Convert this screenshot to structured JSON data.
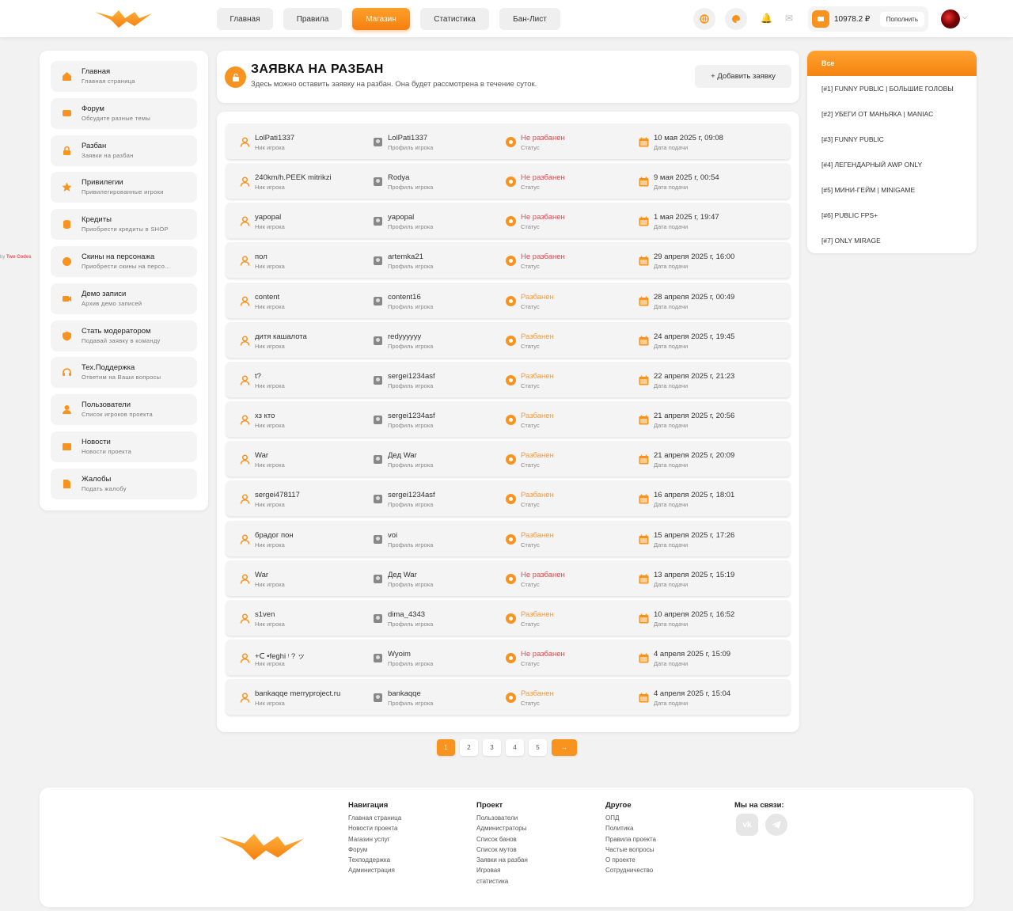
{
  "colors": {
    "accent": "#f7931e",
    "status_not_banned": "#e5484d",
    "status_banned": "#f89a3e"
  },
  "topnav": {
    "items": [
      "Главная",
      "Правила",
      "Магазин",
      "Статистика",
      "Бан-Лист"
    ],
    "active_index": 2
  },
  "balance": {
    "amount": "10978.2 ₽",
    "topup_label": "Пополнить"
  },
  "credit": {
    "prefix": "by",
    "name": "Two Codes"
  },
  "sidebar": {
    "items": [
      {
        "title": "Главная",
        "subtitle": "Главная страница",
        "icon": "home-icon"
      },
      {
        "title": "Форум",
        "subtitle": "Обсудите разные темы",
        "icon": "chat-icon"
      },
      {
        "title": "Разбан",
        "subtitle": "Заявки на разбан",
        "icon": "lock-icon"
      },
      {
        "title": "Привилегии",
        "subtitle": "Привилегированные игроки",
        "icon": "star-icon"
      },
      {
        "title": "Кредиты",
        "subtitle": "Приобрести кредиты в SHOP",
        "icon": "coins-icon"
      },
      {
        "title": "Скины на персонажа",
        "subtitle": "Приобрести скины на персо...",
        "icon": "skin-icon"
      },
      {
        "title": "Демо записи",
        "subtitle": "Архив демо записей",
        "icon": "video-icon"
      },
      {
        "title": "Стать модератором",
        "subtitle": "Подавай заявку в команду",
        "icon": "shield-icon"
      },
      {
        "title": "Тех.Поддержка",
        "subtitle": "Ответим на Ваши вопросы",
        "icon": "headset-icon"
      },
      {
        "title": "Пользователи",
        "subtitle": "Список игроков проекта",
        "icon": "user-icon"
      },
      {
        "title": "Новости",
        "subtitle": "Новости проекта",
        "icon": "news-icon"
      },
      {
        "title": "Жалобы",
        "subtitle": "Подать жалобу",
        "icon": "report-icon"
      }
    ]
  },
  "page": {
    "title": "ЗАЯВКА НА РАЗБАН",
    "subtitle": "Здесь можно оставить заявку на разбан. Она будет рассмотрена в течение суток.",
    "add_button": "+ Добавить заявку"
  },
  "labels": {
    "nick": "Ник игрока",
    "profile": "Профиль игрока",
    "status": "Статус",
    "date": "Дата подачи"
  },
  "appeals": [
    {
      "nick": "LolPati1337",
      "profile": "LolPati1337",
      "status": "Не разбанен",
      "date": "10 мая 2025 г, 09:08"
    },
    {
      "nick": "240km/h.PEEK mitrikzi",
      "profile": "Rodya",
      "status": "Не разбанен",
      "date": "9 мая 2025 г, 00:54"
    },
    {
      "nick": "yapopal",
      "profile": "yapopal",
      "status": "Не разбанен",
      "date": "1 мая 2025 г, 19:47"
    },
    {
      "nick": "пол",
      "profile": "artemka21",
      "status": "Не разбанен",
      "date": "29 апреля 2025 г, 16:00"
    },
    {
      "nick": "content",
      "profile": "content16",
      "status": "Разбанен",
      "date": "28 апреля 2025 г, 00:49"
    },
    {
      "nick": "дитя кашалота",
      "profile": "redyyyyyy",
      "status": "Разбанен",
      "date": "24 апреля 2025 г, 19:45"
    },
    {
      "nick": "t?",
      "profile": "sergei1234asf",
      "status": "Разбанен",
      "date": "22 апреля 2025 г, 21:23"
    },
    {
      "nick": "хз кто",
      "profile": "sergei1234asf",
      "status": "Разбанен",
      "date": "21 апреля 2025 г, 20:56"
    },
    {
      "nick": "War",
      "profile": "Дед War",
      "status": "Разбанен",
      "date": "21 апреля 2025 г, 20:09"
    },
    {
      "nick": "sergei478117",
      "profile": "sergei1234asf",
      "status": "Разбанен",
      "date": "16 апреля 2025 г, 18:01"
    },
    {
      "nick": "брадог пон",
      "profile": "voi",
      "status": "Разбанен",
      "date": "15 апреля 2025 г, 17:26"
    },
    {
      "nick": "War",
      "profile": "Дед War",
      "status": "Не разбанен",
      "date": "13 апреля 2025 г, 15:19"
    },
    {
      "nick": "s1ven",
      "profile": "dima_4343",
      "status": "Разбанен",
      "date": "10 апреля 2025 г, 16:52"
    },
    {
      "nick": "+ᑕ •feghi ᵎ ? ッ",
      "profile": "Wyoim",
      "status": "Не разбанен",
      "date": "4 апреля 2025 г, 15:09"
    },
    {
      "nick": "bankaqqe merryproject.ru",
      "profile": "bankaqqe",
      "status": "Разбанен",
      "date": "4 апреля 2025 г, 15:04"
    }
  ],
  "pagination": {
    "pages": [
      "1",
      "2",
      "3",
      "4",
      "5"
    ],
    "current": "1",
    "next": "→"
  },
  "servers": {
    "all_label": "Все",
    "items": [
      "[#1] FUNNY PUBLIC | БОЛЬШИЕ ГОЛОВЫ",
      "[#2] УБЕГИ ОТ МАНЬЯКА | MANIAC",
      "[#3] FUNNY PUBLIC",
      "[#4] ЛЕГЕНДАРНЫЙ AWP ONLY",
      "[#5] МИНИ-ГЕЙМ | MINIGAME",
      "[#6] PUBLIC FPS+",
      "[#7] ONLY MIRAGE"
    ]
  },
  "footer": {
    "nav": {
      "title": "Навигация",
      "links": [
        "Главная страница",
        "Новости проекта",
        "Магазин услуг",
        "Форум",
        "Техподдержка",
        "Администрация"
      ]
    },
    "project": {
      "title": "Проект",
      "links": [
        "Пользователи",
        "Администраторы",
        "Список банов",
        "Список мутов",
        "Заявки на разбан",
        "Игровая",
        "статистика"
      ]
    },
    "other": {
      "title": "Другое",
      "links": [
        "ОПД",
        "Политика",
        "Правила проекта",
        "Частые вопросы",
        "О проекте",
        "Сотрудничество"
      ]
    },
    "social": {
      "title": "Мы на связи:",
      "vk_icon": "vk-icon",
      "telegram_icon": "telegram-icon"
    }
  }
}
